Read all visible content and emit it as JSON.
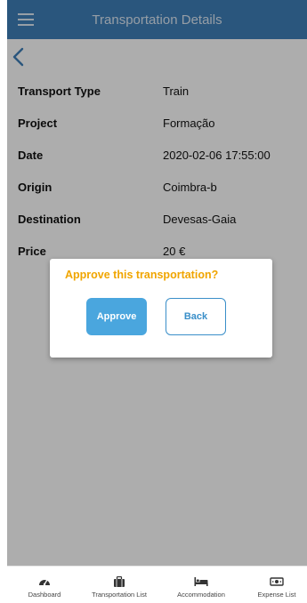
{
  "header": {
    "title": "Transportation Details",
    "menu_icon": "hamburger-icon"
  },
  "back": {
    "icon": "chevron-left-icon"
  },
  "details": [
    {
      "label": "Transport Type",
      "value": "Train"
    },
    {
      "label": "Project",
      "value": "Formação"
    },
    {
      "label": "Date",
      "value": "2020-02-06 17:55:00"
    },
    {
      "label": "Origin",
      "value": "Coimbra-b"
    },
    {
      "label": "Destination",
      "value": "Devesas-Gaia"
    },
    {
      "label": "Price",
      "value": "20 €"
    }
  ],
  "dialog": {
    "title": "Approve this transportation?",
    "approve_label": "Approve",
    "back_label": "Back"
  },
  "bottom_nav": [
    {
      "label": "Dashboard",
      "icon": "dashboard-gauge-icon"
    },
    {
      "label": "Transportation List",
      "icon": "suitcase-icon"
    },
    {
      "label": "Accommodation",
      "icon": "bed-icon"
    },
    {
      "label": "Expense List",
      "icon": "banknote-icon"
    }
  ],
  "colors": {
    "header": "#3f7fb9",
    "accent": "#4aa6de",
    "dialog_title": "#f0a500"
  }
}
